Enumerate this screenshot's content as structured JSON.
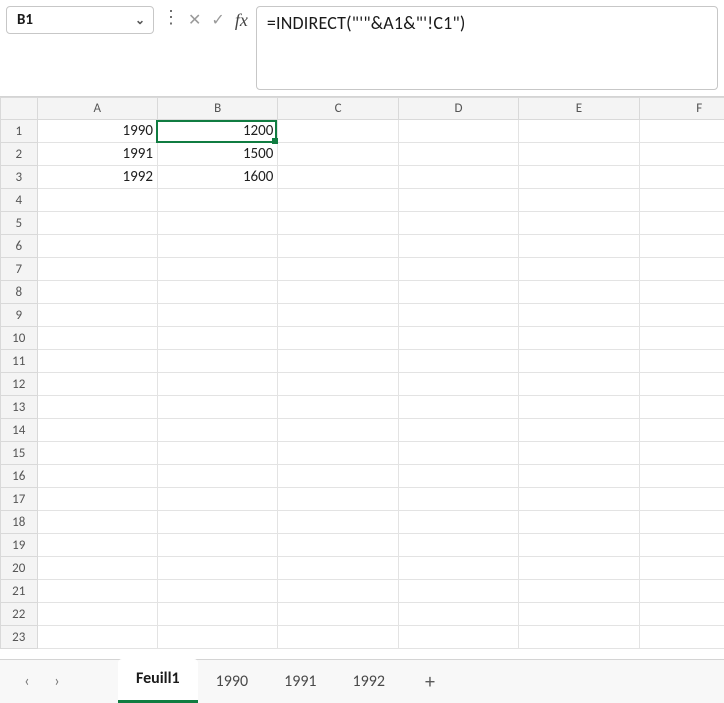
{
  "name_box": {
    "value": "B1"
  },
  "formula_bar": {
    "value": "=INDIRECT(\"'\"&A1&\"'!C1\")"
  },
  "columns": [
    "A",
    "B",
    "C",
    "D",
    "E",
    "F"
  ],
  "rows": [
    "1",
    "2",
    "3",
    "4",
    "5",
    "6",
    "7",
    "8",
    "9",
    "10",
    "11",
    "12",
    "13",
    "14",
    "15",
    "16",
    "17",
    "18",
    "19",
    "20",
    "21",
    "22",
    "23"
  ],
  "cells": {
    "A1": "1990",
    "B1": "1200",
    "A2": "1991",
    "B2": "1500",
    "A3": "1992",
    "B3": "1600"
  },
  "active_cell": {
    "col": "B",
    "row": "1"
  },
  "tabs": {
    "items": [
      {
        "label": "Feuill1",
        "active": true
      },
      {
        "label": "1990",
        "active": false
      },
      {
        "label": "1991",
        "active": false
      },
      {
        "label": "1992",
        "active": false
      }
    ],
    "add_label": "+"
  },
  "icons": {
    "dropdown": "⌄",
    "menu_dots": "⋮",
    "cancel": "✕",
    "accept": "✓",
    "fx": "fx",
    "nav_prev": "‹",
    "nav_next": "›",
    "add": "+"
  },
  "chart_data": {
    "type": "table",
    "columns": [
      "A",
      "B"
    ],
    "rows": [
      {
        "A": 1990,
        "B": 1200
      },
      {
        "A": 1991,
        "B": 1500
      },
      {
        "A": 1992,
        "B": 1600
      }
    ]
  }
}
